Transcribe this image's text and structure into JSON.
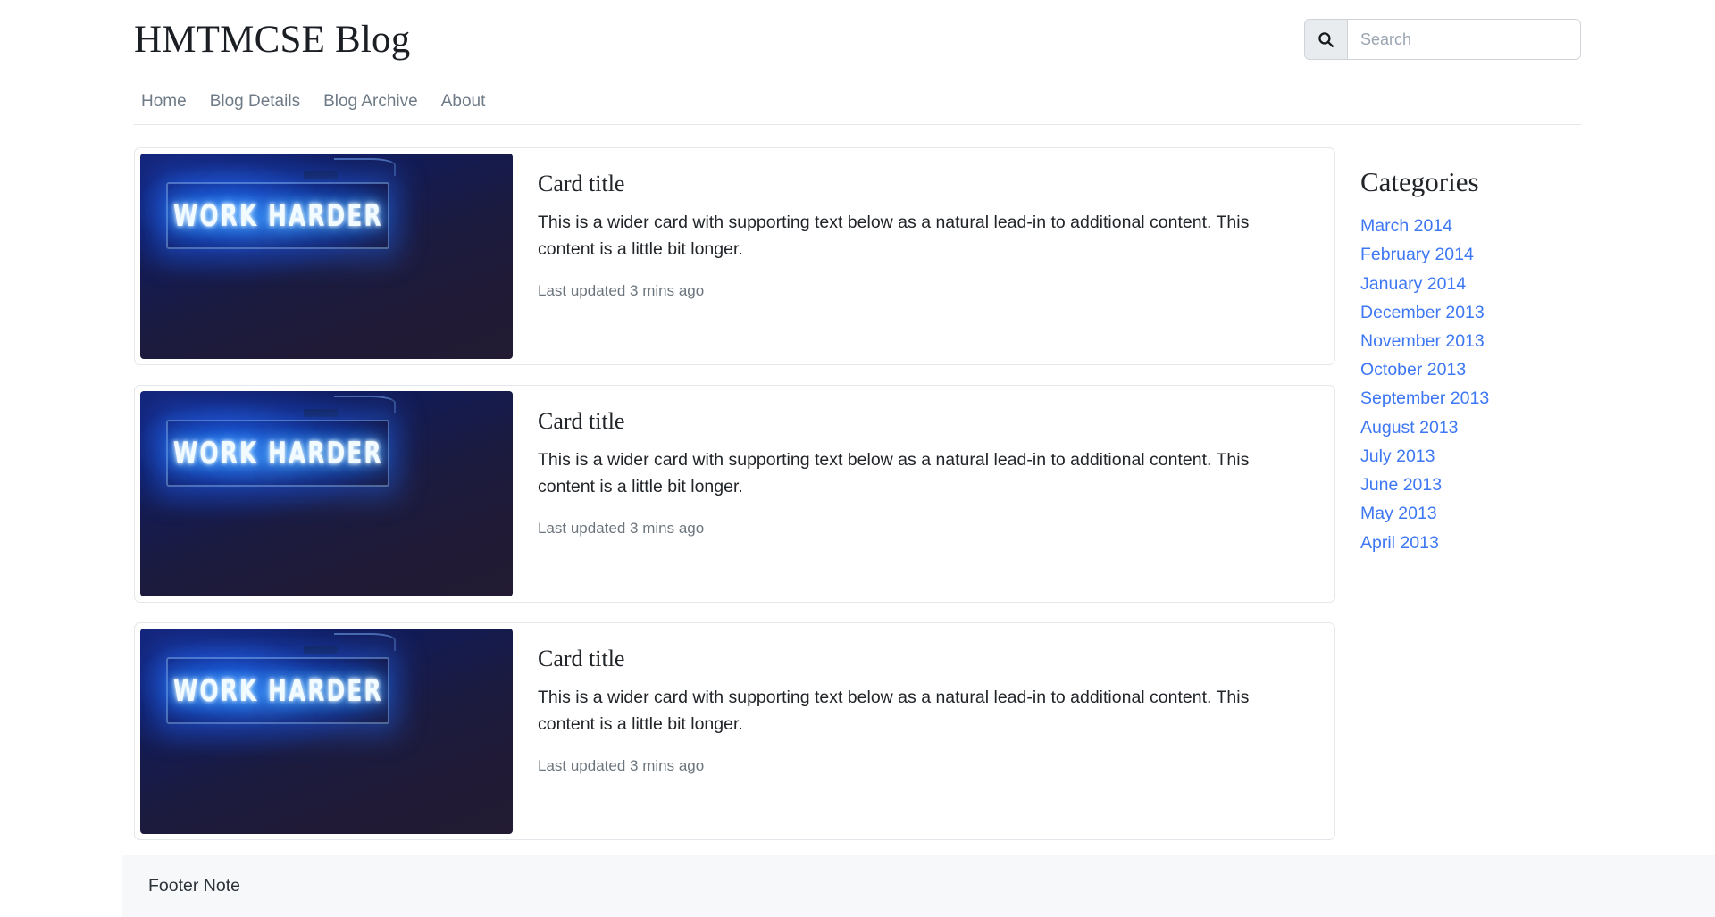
{
  "header": {
    "brand": "HMTMCSE Blog",
    "search": {
      "placeholder": "Search",
      "value": "",
      "icon": "search-icon"
    }
  },
  "nav": {
    "items": [
      {
        "label": "Home"
      },
      {
        "label": "Blog Details"
      },
      {
        "label": "Blog Archive"
      },
      {
        "label": "About"
      }
    ]
  },
  "posts": [
    {
      "title": "Card title",
      "text": "This is a wider card with supporting text below as a natural lead-in to additional content. This content is a little bit longer.",
      "meta": "Last updated 3 mins ago",
      "image_alt": "WORK HARDER"
    },
    {
      "title": "Card title",
      "text": "This is a wider card with supporting text below as a natural lead-in to additional content. This content is a little bit longer.",
      "meta": "Last updated 3 mins ago",
      "image_alt": "WORK HARDER"
    },
    {
      "title": "Card title",
      "text": "This is a wider card with supporting text below as a natural lead-in to additional content. This content is a little bit longer.",
      "meta": "Last updated 3 mins ago",
      "image_alt": "WORK HARDER"
    }
  ],
  "sidebar": {
    "title": "Categories",
    "categories": [
      {
        "label": "March 2014"
      },
      {
        "label": "February 2014"
      },
      {
        "label": "January 2014"
      },
      {
        "label": "December 2013"
      },
      {
        "label": "November 2013"
      },
      {
        "label": "October 2013"
      },
      {
        "label": "September 2013"
      },
      {
        "label": "August 2013"
      },
      {
        "label": "July 2013"
      },
      {
        "label": "June 2013"
      },
      {
        "label": "May 2013"
      },
      {
        "label": "April 2013"
      }
    ]
  },
  "footer": {
    "note": "Footer Note"
  },
  "colors": {
    "link": "#3d77f3",
    "muted": "#6c757d",
    "border": "#e3e6ea",
    "footer_bg": "#f6f8fa",
    "nav_text": "#6f7b87"
  }
}
